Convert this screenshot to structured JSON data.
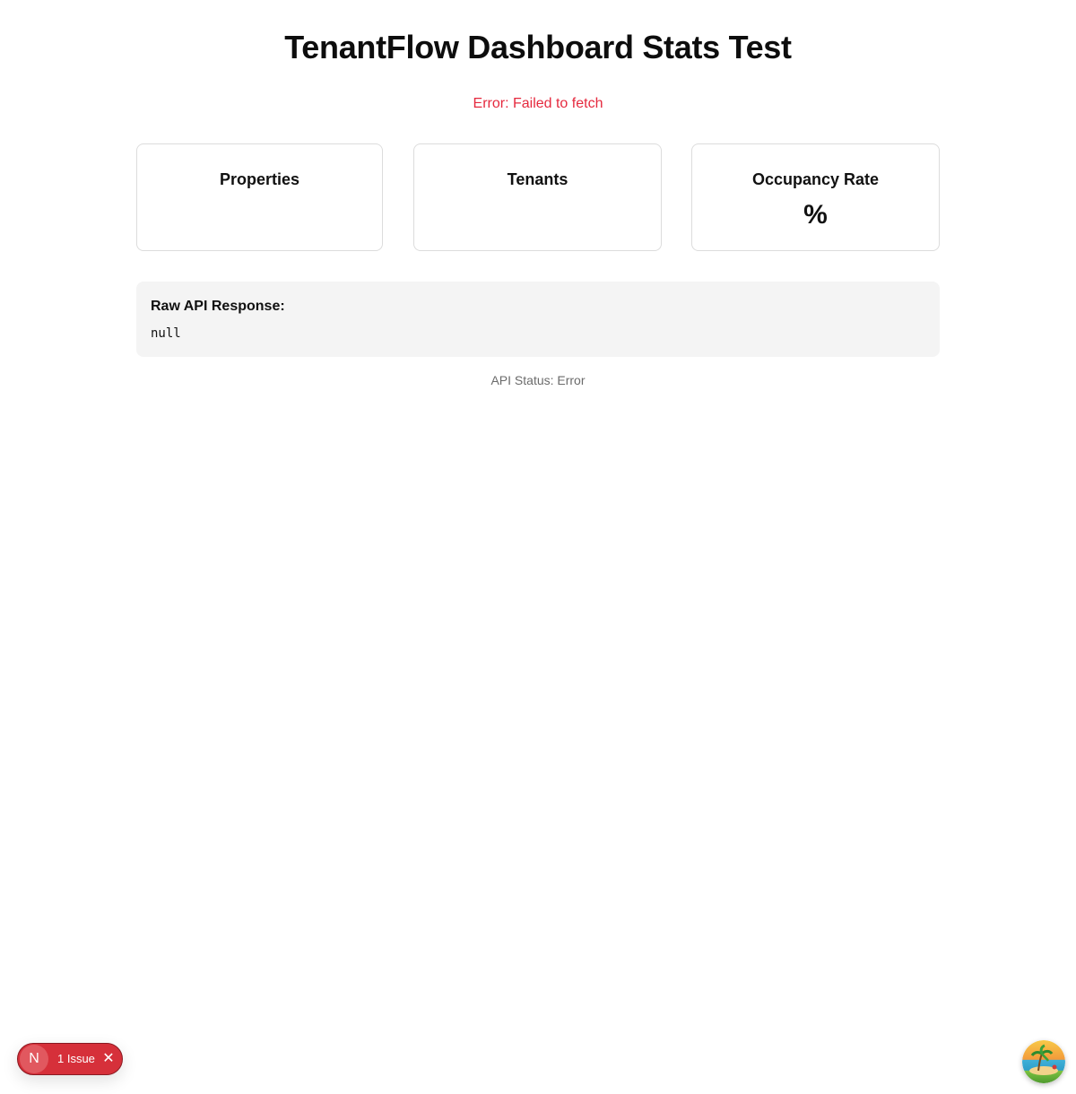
{
  "page": {
    "title": "TenantFlow Dashboard Stats Test",
    "error_message": "Error: Failed to fetch"
  },
  "stats": {
    "cards": [
      {
        "title": "Properties",
        "value": ""
      },
      {
        "title": "Tenants",
        "value": ""
      },
      {
        "title": "Occupancy Rate",
        "value": "%"
      }
    ]
  },
  "raw_response": {
    "title": "Raw API Response:",
    "value": "null"
  },
  "api_status": "API Status: Error",
  "dev_overlay": {
    "logo_letter": "N",
    "issue_label": "1 Issue",
    "close_glyph": "✕",
    "pill_color": "#d6303a"
  },
  "colors": {
    "error_text": "#e5293e",
    "muted_text": "#6b6b6b",
    "panel_bg": "#f4f4f4"
  }
}
